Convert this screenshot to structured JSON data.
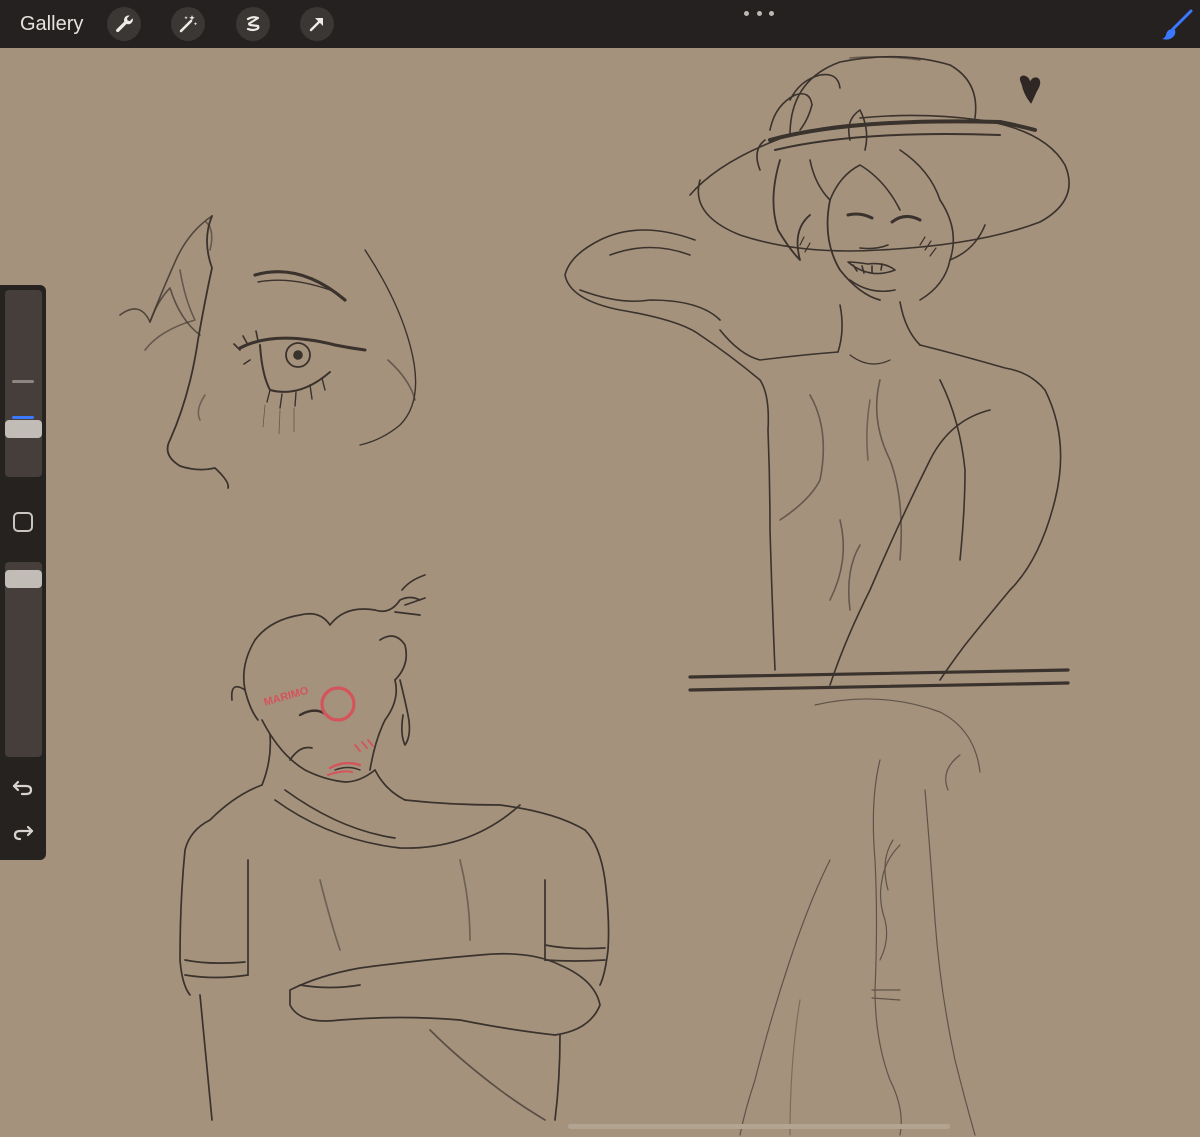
{
  "toolbar": {
    "gallery_label": "Gallery",
    "tools": [
      {
        "name": "actions",
        "icon": "wrench-icon"
      },
      {
        "name": "adjustments",
        "icon": "magic-wand-icon"
      },
      {
        "name": "selection",
        "icon": "selection-s-icon"
      },
      {
        "name": "transform",
        "icon": "arrow-cursor-icon"
      }
    ],
    "more_icon": "more-dots-icon",
    "brush_icon": "brush-icon",
    "accent_color": "#3a78ff"
  },
  "sidebar": {
    "brush_size_icon": "slider-icon",
    "modify_icon": "square-icon",
    "brush_opacity_icon": "slider-icon",
    "undo_icon": "undo-arrow-icon",
    "redo_icon": "redo-arrow-icon"
  },
  "canvas": {
    "background_color": "#a5927d",
    "stroke_color": "#3a322c",
    "highlight_color": "#d4545c",
    "annotation_text": "MARIMO",
    "heart_icon": "heart-icon"
  }
}
